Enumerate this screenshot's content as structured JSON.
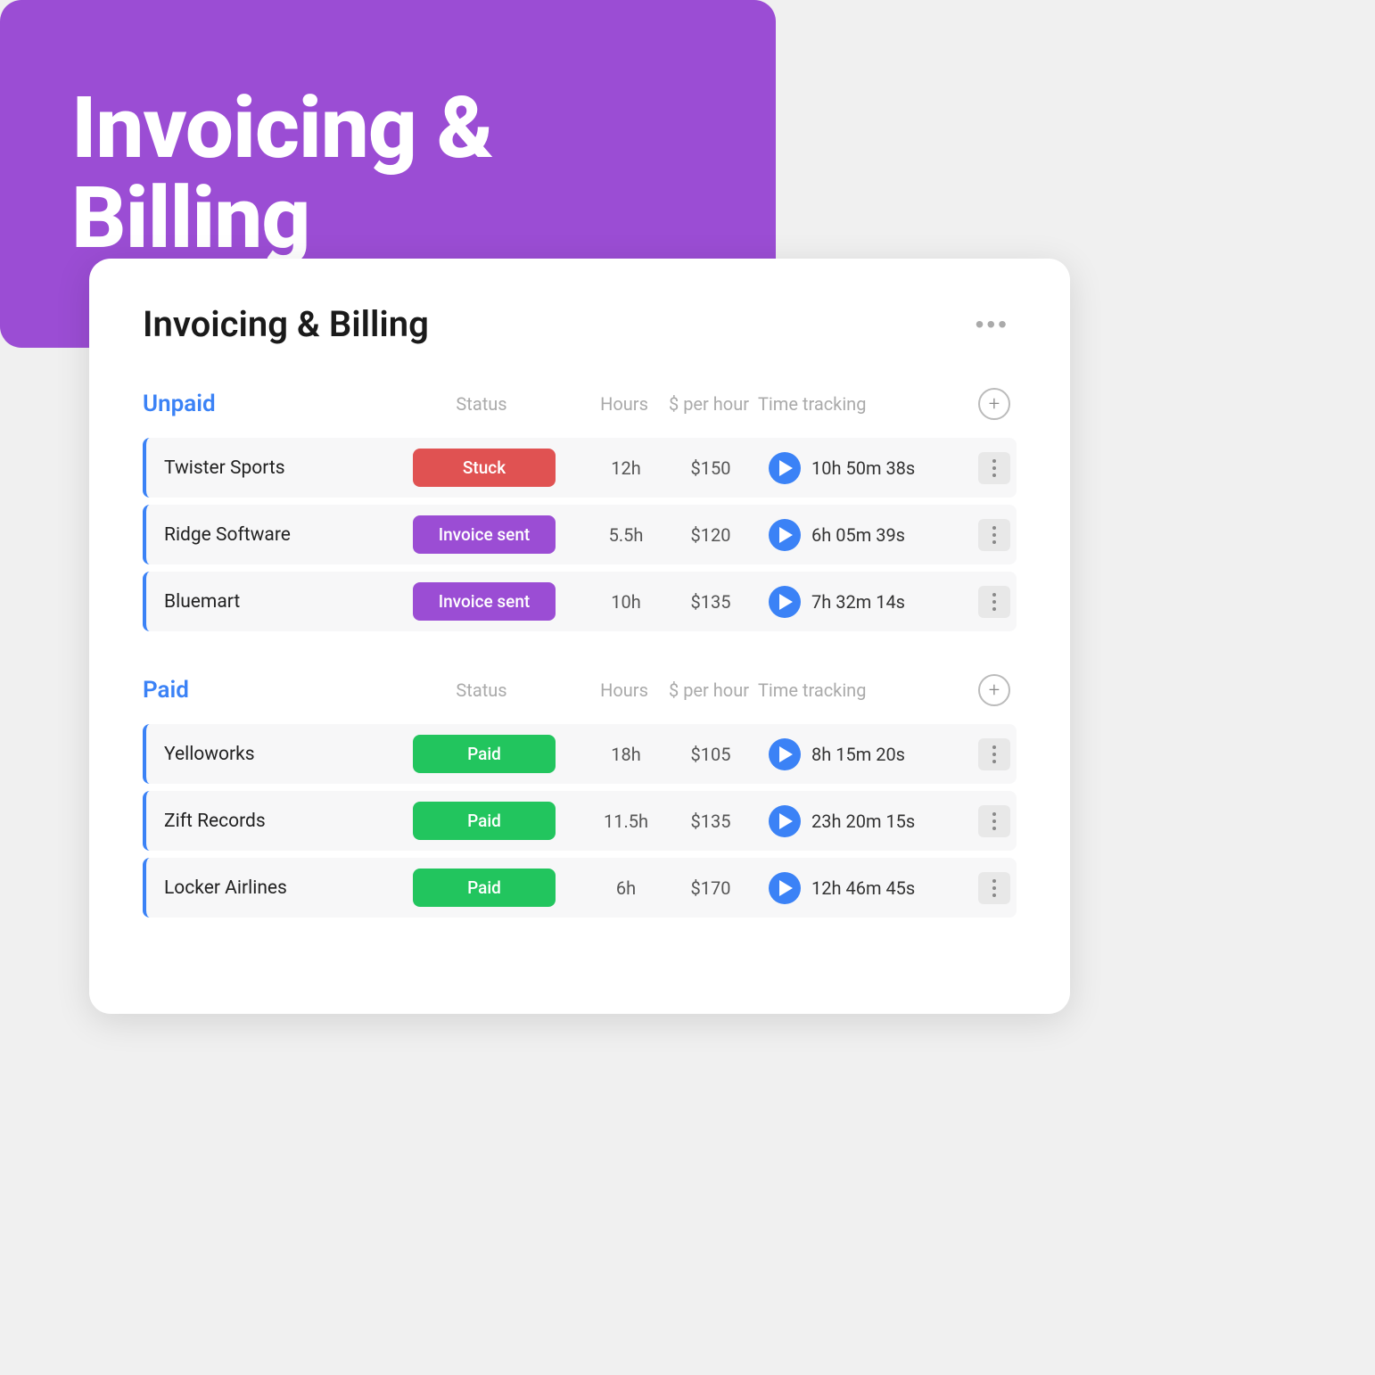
{
  "hero": {
    "title_line1": "Invoicing &",
    "title_line2": "Billing",
    "bg_color": "#9b4dd4"
  },
  "card": {
    "title": "Invoicing & Billing",
    "more_icon": "•••",
    "unpaid_section": {
      "label": "Unpaid",
      "col_status": "Status",
      "col_hours": "Hours",
      "col_rate": "$ per hour",
      "col_time": "Time tracking",
      "rows": [
        {
          "client": "Twister Sports",
          "status": "Stuck",
          "status_type": "stuck",
          "hours": "12h",
          "rate": "$150",
          "time": "10h 50m 38s"
        },
        {
          "client": "Ridge Software",
          "status": "Invoice sent",
          "status_type": "invoice-sent",
          "hours": "5.5h",
          "rate": "$120",
          "time": "6h 05m 39s"
        },
        {
          "client": "Bluemart",
          "status": "Invoice sent",
          "status_type": "invoice-sent",
          "hours": "10h",
          "rate": "$135",
          "time": "7h 32m 14s"
        }
      ]
    },
    "paid_section": {
      "label": "Paid",
      "col_status": "Status",
      "col_hours": "Hours",
      "col_rate": "$ per hour",
      "col_time": "Time tracking",
      "rows": [
        {
          "client": "Yelloworks",
          "status": "Paid",
          "status_type": "paid",
          "hours": "18h",
          "rate": "$105",
          "time": "8h 15m 20s"
        },
        {
          "client": "Zift Records",
          "status": "Paid",
          "status_type": "paid",
          "hours": "11.5h",
          "rate": "$135",
          "time": "23h 20m 15s"
        },
        {
          "client": "Locker Airlines",
          "status": "Paid",
          "status_type": "paid",
          "hours": "6h",
          "rate": "$170",
          "time": "12h 46m 45s"
        }
      ]
    }
  }
}
